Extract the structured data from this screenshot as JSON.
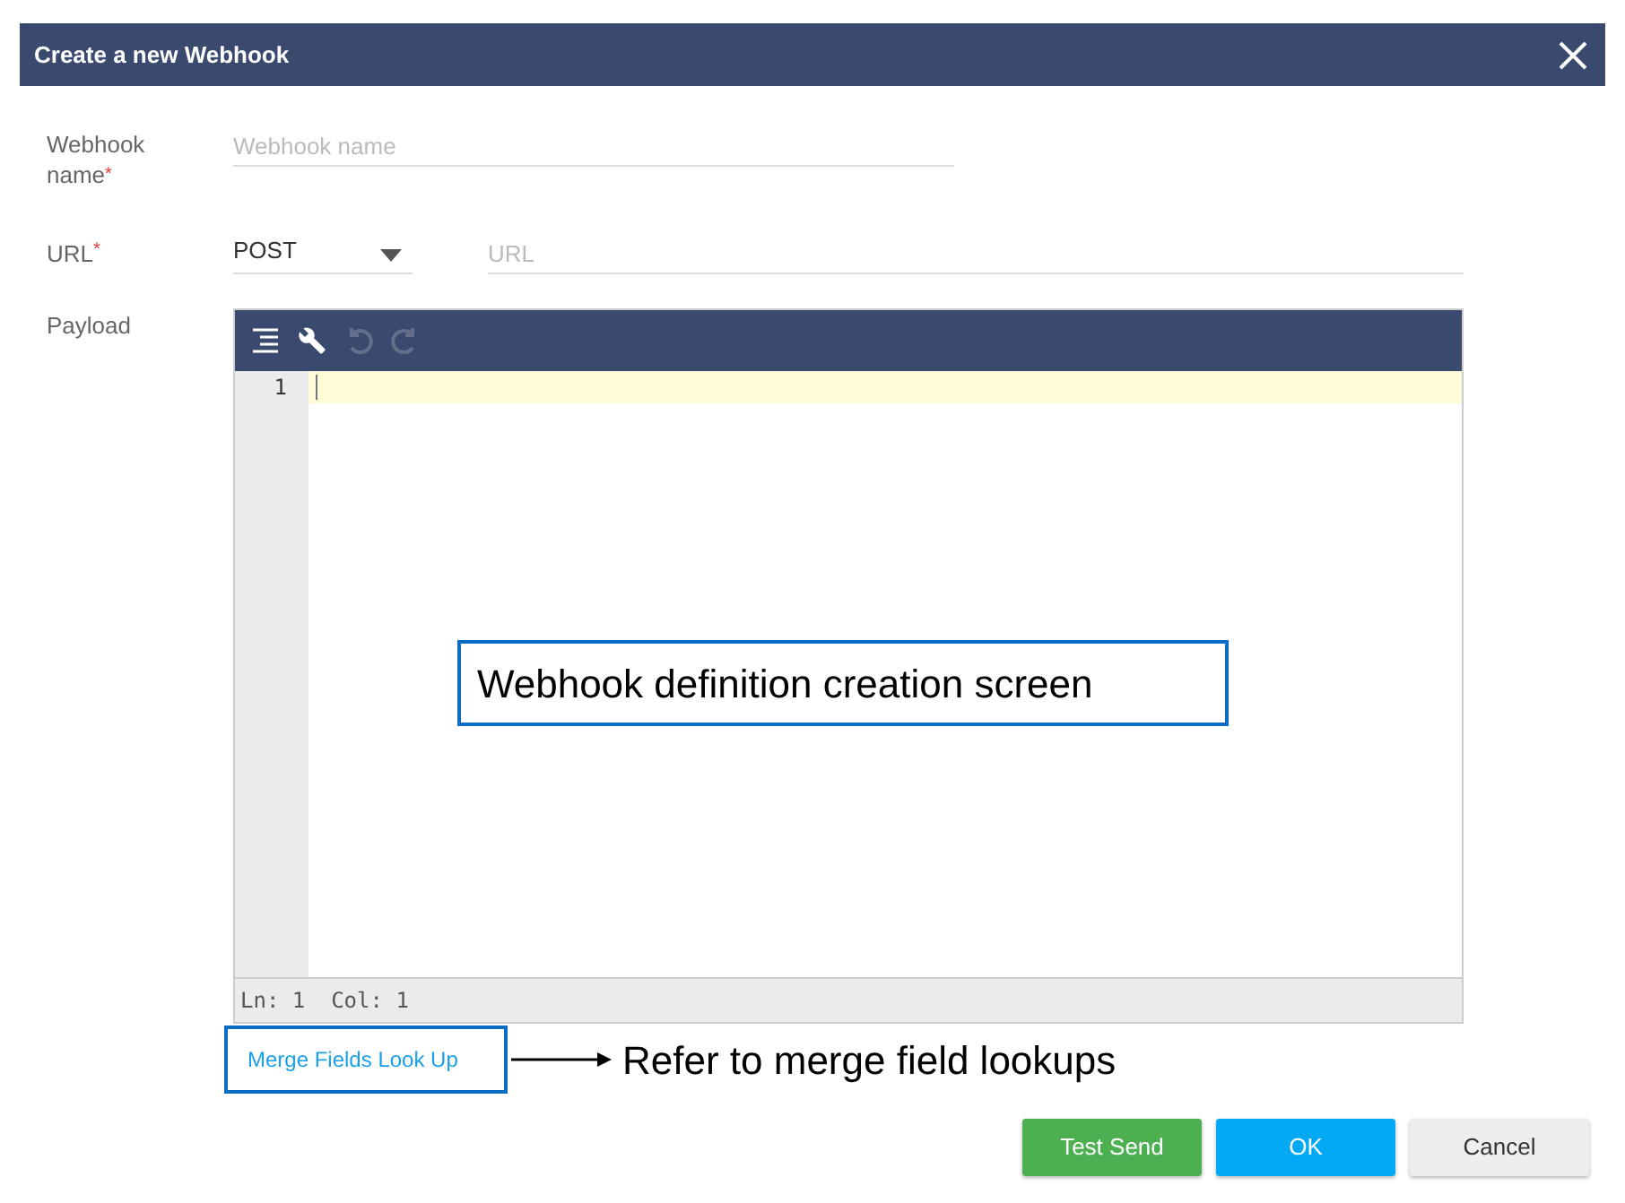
{
  "dialog": {
    "title": "Create a new Webhook"
  },
  "form": {
    "name_label": "Webhook name",
    "name_required": true,
    "required_mark": "*",
    "name_placeholder": "Webhook name",
    "url_label": "URL",
    "url_required": true,
    "method": "POST",
    "url_placeholder": "URL",
    "payload_label": "Payload"
  },
  "editor": {
    "toolbar": [
      {
        "kind": "format",
        "disabled": false
      },
      {
        "kind": "settings",
        "disabled": false
      },
      {
        "kind": "undo",
        "disabled": true
      },
      {
        "kind": "redo",
        "disabled": true
      }
    ],
    "line_numbers": [
      "1"
    ],
    "status": "Ln: 1  Col: 1"
  },
  "callouts": [
    {
      "text": "Webhook definition creation screen"
    },
    {
      "text": "Refer to merge field lookups"
    }
  ],
  "merge_link": "Merge Fields Look Up",
  "buttons": [
    {
      "kind": "test",
      "label": "Test Send"
    },
    {
      "kind": "primary",
      "label": "OK"
    },
    {
      "kind": "cancel",
      "label": "Cancel"
    }
  ]
}
